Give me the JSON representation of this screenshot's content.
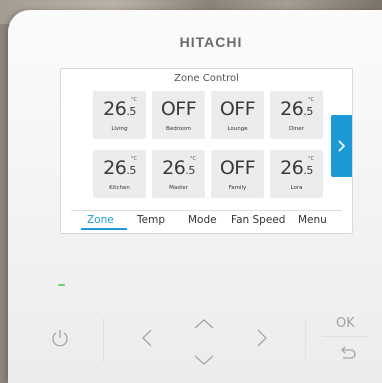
{
  "brand": "HITACHI",
  "screen": {
    "title": "Zone Control",
    "zones": [
      {
        "main": "26",
        "dec": ".5",
        "unit": "°C",
        "name": "Living"
      },
      {
        "main": "OFF",
        "dec": "",
        "unit": "",
        "name": "Bedroom"
      },
      {
        "main": "OFF",
        "dec": "",
        "unit": "",
        "name": "Lounge"
      },
      {
        "main": "26",
        "dec": ".5",
        "unit": "°C",
        "name": "Diner"
      },
      {
        "main": "26",
        "dec": ".5",
        "unit": "°C",
        "name": "Kitchen"
      },
      {
        "main": "26",
        "dec": ".5",
        "unit": "°C",
        "name": "Master"
      },
      {
        "main": "OFF",
        "dec": "",
        "unit": "",
        "name": "Family"
      },
      {
        "main": "26",
        "dec": ".5",
        "unit": "°C",
        "name": "Lora"
      }
    ],
    "menu": [
      "Zone",
      "Temp",
      "Mode",
      "Fan Speed",
      "Menu"
    ],
    "active_menu": "Zone",
    "accent_color": "#1d9ad6"
  },
  "buttons": {
    "ok": "OK"
  },
  "icons": [
    "power-icon",
    "arrow-left-icon",
    "arrow-up-icon",
    "arrow-down-icon",
    "arrow-right-icon",
    "back-icon",
    "chevron-right-icon"
  ]
}
